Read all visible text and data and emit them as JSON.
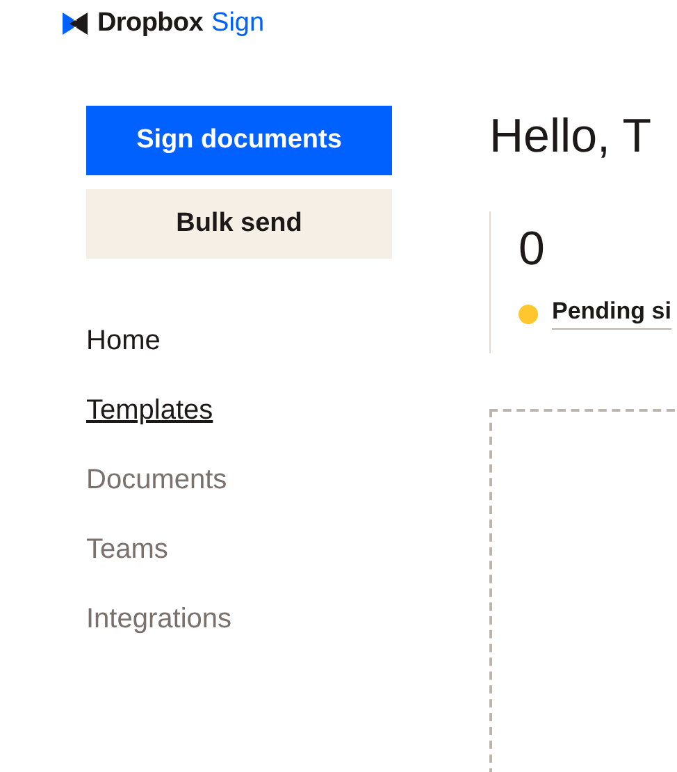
{
  "logo": {
    "brand": "Dropbox",
    "product": "Sign"
  },
  "buttons": [
    {
      "label": "Sign documents",
      "kind": "primary"
    },
    {
      "label": "Bulk send",
      "kind": "secondary"
    }
  ],
  "nav": [
    {
      "label": "Home",
      "disabled": false,
      "hovered": false
    },
    {
      "label": "Templates",
      "disabled": false,
      "hovered": true
    },
    {
      "label": "Documents",
      "disabled": true,
      "hovered": false
    },
    {
      "label": "Teams",
      "disabled": true,
      "hovered": false
    },
    {
      "label": "Integrations",
      "disabled": true,
      "hovered": false
    }
  ],
  "greeting": "Hello, T",
  "stat": {
    "count": "0",
    "label": "Pending si",
    "color": "#ffc62e"
  }
}
